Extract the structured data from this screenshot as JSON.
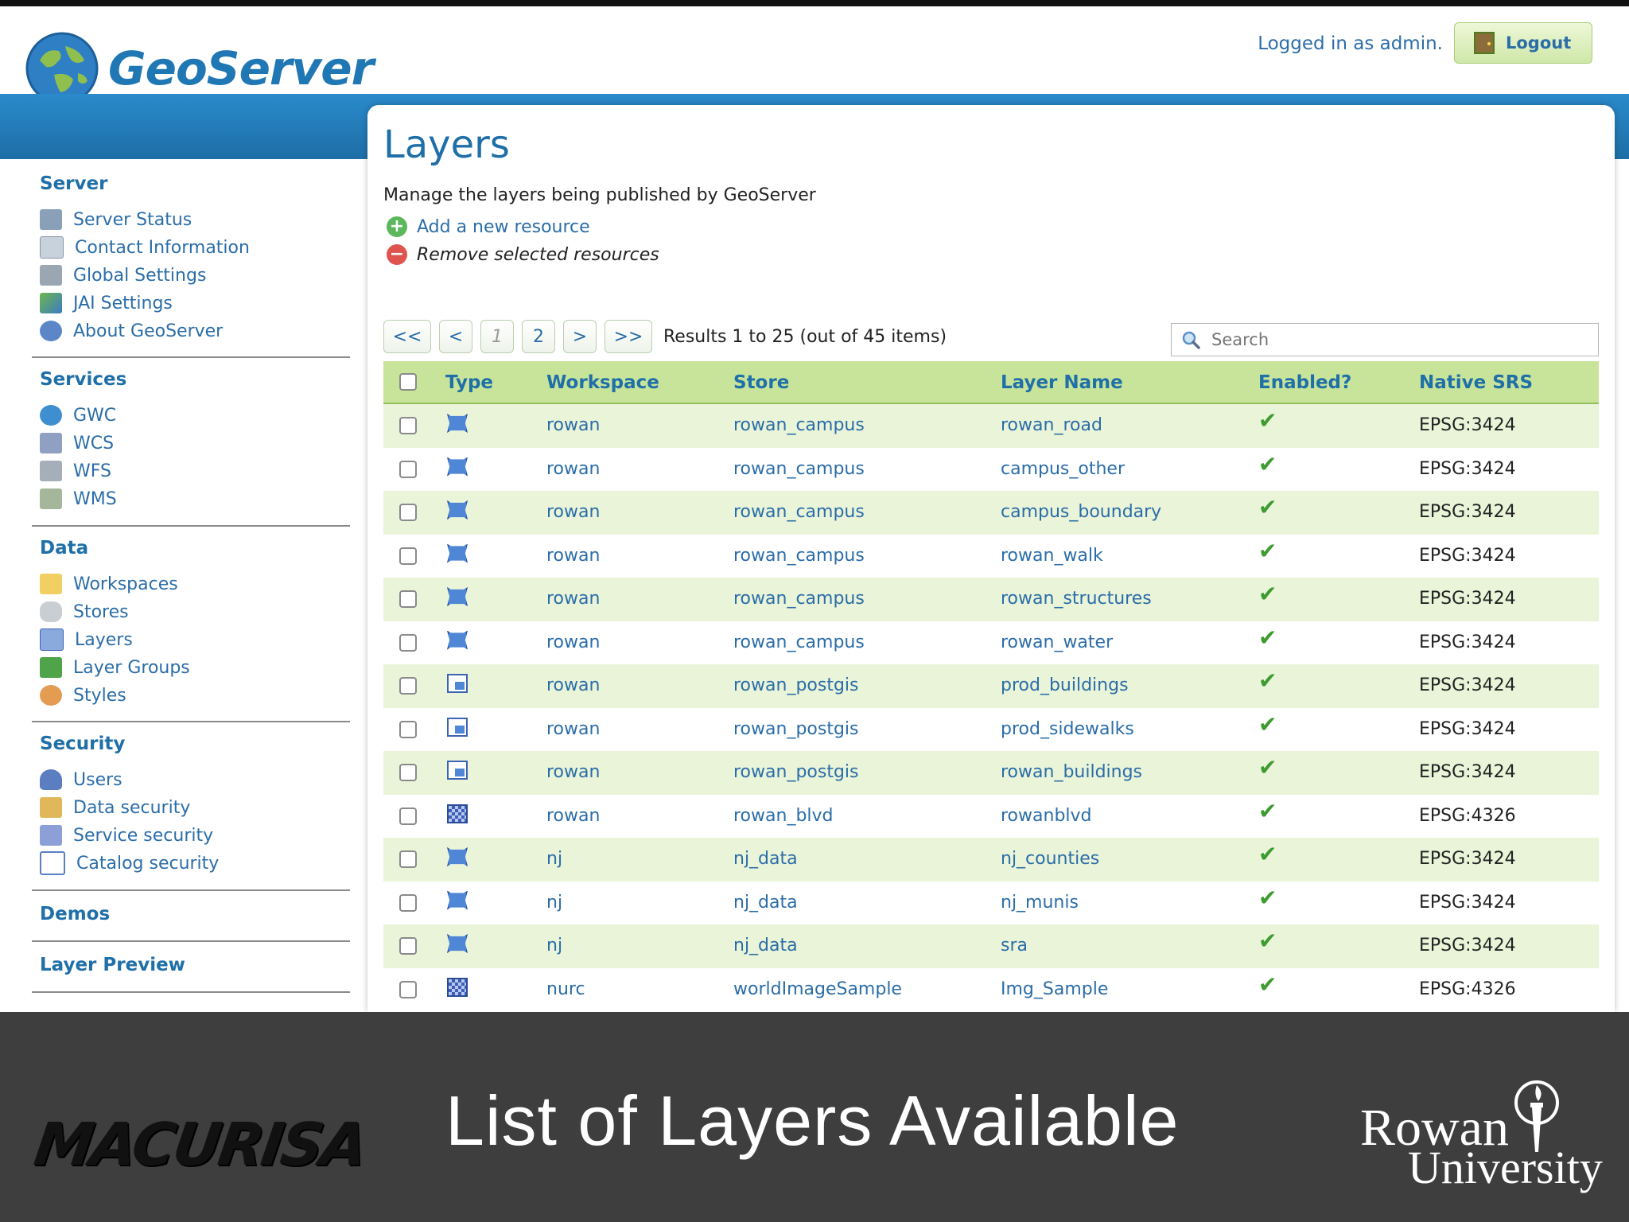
{
  "app": {
    "logo_text": "GeoServer",
    "logged_in": "Logged in as admin.",
    "logout_label": "Logout"
  },
  "sidebar": {
    "sections": [
      {
        "title": "Server",
        "items": [
          "Server Status",
          "Contact Information",
          "Global Settings",
          "JAI Settings",
          "About GeoServer"
        ]
      },
      {
        "title": "Services",
        "items": [
          "GWC",
          "WCS",
          "WFS",
          "WMS"
        ]
      },
      {
        "title": "Data",
        "items": [
          "Workspaces",
          "Stores",
          "Layers",
          "Layer Groups",
          "Styles"
        ]
      },
      {
        "title": "Security",
        "items": [
          "Users",
          "Data security",
          "Service security",
          "Catalog security"
        ]
      },
      {
        "title": "Demos",
        "items": []
      },
      {
        "title": "Layer Preview",
        "items": []
      }
    ]
  },
  "main": {
    "title": "Layers",
    "description": "Manage the layers being published by GeoServer",
    "add_resource": "Add a new resource",
    "remove_resources": "Remove selected resources",
    "pager": {
      "first": "<<",
      "prev": "<",
      "page1": "1",
      "page2": "2",
      "next": ">",
      "last": ">>"
    },
    "results": "Results 1 to 25 (out of 45 items)",
    "search_placeholder": "Search",
    "columns": [
      "Type",
      "Workspace",
      "Store",
      "Layer Name",
      "Enabled?",
      "Native SRS"
    ],
    "rows": [
      {
        "type": "polygon",
        "workspace": "rowan",
        "store": "rowan_campus",
        "layer": "rowan_road",
        "enabled": "✔",
        "srs": "EPSG:3424"
      },
      {
        "type": "polygon",
        "workspace": "rowan",
        "store": "rowan_campus",
        "layer": "campus_other",
        "enabled": "✔",
        "srs": "EPSG:3424"
      },
      {
        "type": "polygon",
        "workspace": "rowan",
        "store": "rowan_campus",
        "layer": "campus_boundary",
        "enabled": "✔",
        "srs": "EPSG:3424"
      },
      {
        "type": "polygon",
        "workspace": "rowan",
        "store": "rowan_campus",
        "layer": "rowan_walk",
        "enabled": "✔",
        "srs": "EPSG:3424"
      },
      {
        "type": "polygon",
        "workspace": "rowan",
        "store": "rowan_campus",
        "layer": "rowan_structures",
        "enabled": "✔",
        "srs": "EPSG:3424"
      },
      {
        "type": "polygon",
        "workspace": "rowan",
        "store": "rowan_campus",
        "layer": "rowan_water",
        "enabled": "✔",
        "srs": "EPSG:3424"
      },
      {
        "type": "line",
        "workspace": "rowan",
        "store": "rowan_postgis",
        "layer": "prod_buildings",
        "enabled": "✔",
        "srs": "EPSG:3424"
      },
      {
        "type": "line",
        "workspace": "rowan",
        "store": "rowan_postgis",
        "layer": "prod_sidewalks",
        "enabled": "✔",
        "srs": "EPSG:3424"
      },
      {
        "type": "line",
        "workspace": "rowan",
        "store": "rowan_postgis",
        "layer": "rowan_buildings",
        "enabled": "✔",
        "srs": "EPSG:3424"
      },
      {
        "type": "raster",
        "workspace": "rowan",
        "store": "rowan_blvd",
        "layer": "rowanblvd",
        "enabled": "✔",
        "srs": "EPSG:4326"
      },
      {
        "type": "polygon",
        "workspace": "nj",
        "store": "nj_data",
        "layer": "nj_counties",
        "enabled": "✔",
        "srs": "EPSG:3424"
      },
      {
        "type": "polygon",
        "workspace": "nj",
        "store": "nj_data",
        "layer": "nj_munis",
        "enabled": "✔",
        "srs": "EPSG:3424"
      },
      {
        "type": "polygon",
        "workspace": "nj",
        "store": "nj_data",
        "layer": "sra",
        "enabled": "✔",
        "srs": "EPSG:3424"
      },
      {
        "type": "raster",
        "workspace": "nurc",
        "store": "worldImageSample",
        "layer": "Img_Sample",
        "enabled": "✔",
        "srs": "EPSG:4326"
      }
    ]
  },
  "footer": {
    "title": "List of Layers Available",
    "left_logo": "MACURISA",
    "right_logo_line1": "Rowan",
    "right_logo_line2": "University"
  },
  "colors": {
    "accent_blue": "#1f6fa8",
    "header_bar": "#2a8acb",
    "table_header": "#c8e49a",
    "row_alt": "#e9f4d9",
    "enabled_check": "#3d9b2f",
    "footer_bg": "#3e3e3e"
  }
}
